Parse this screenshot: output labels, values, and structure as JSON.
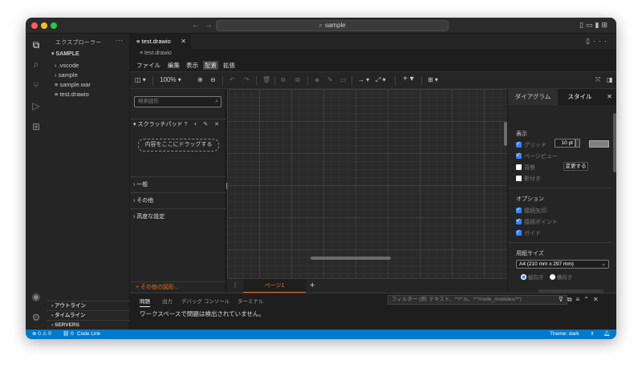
{
  "window": {
    "title": "sample"
  },
  "explorer": {
    "header": "エクスプローラー",
    "more": "···",
    "root": "SAMPLE",
    "items": [
      {
        "label": ".vscode",
        "kind": "folder"
      },
      {
        "label": "sample",
        "kind": "folder"
      },
      {
        "label": "sample.war",
        "kind": "file"
      },
      {
        "label": "test.drawio",
        "kind": "file"
      }
    ],
    "sections": [
      "アウトライン",
      "タイムライン",
      "SERVERS"
    ]
  },
  "editor": {
    "tab_label": "test.drawio",
    "breadcrumb": "test.drawio"
  },
  "menu": {
    "items": [
      "ファイル",
      "編集",
      "表示",
      "配置",
      "拡張"
    ],
    "highlighted": "配置"
  },
  "toolbar": {
    "zoom": "100%"
  },
  "shapes_panel": {
    "search_placeholder": "検索図形",
    "scratchpad_label": "スクラッチパッド",
    "scratchpad_tools": "? + ✎ ✕",
    "drop_hint": "内容をここにドラッグする",
    "sections": [
      "一般",
      "その他",
      "高度な設定"
    ],
    "more_shapes": "+ その他の図形..."
  },
  "pages": {
    "active": "ページ1"
  },
  "format_panel": {
    "tabs": [
      "ダイアグラム",
      "スタイル"
    ],
    "view_label": "表示",
    "view_options": [
      {
        "label": "グリッド",
        "checked": true
      },
      {
        "label": "ページビュー",
        "checked": true
      },
      {
        "label": "背景",
        "checked": false
      },
      {
        "label": "影付き",
        "checked": false
      }
    ],
    "grid_size": "10 pt",
    "change_button": "変更する",
    "options_label": "オプション",
    "options": [
      {
        "label": "接続矢印",
        "checked": true
      },
      {
        "label": "接続ポイント",
        "checked": true
      },
      {
        "label": "ガイド",
        "checked": true
      }
    ],
    "paper_label": "用紙サイズ",
    "paper_value": "A4 (210 mm x 297 mm)",
    "orientation": [
      "縦向き",
      "横向き"
    ],
    "orientation_selected": "縦向き"
  },
  "panel": {
    "tabs": [
      "問題",
      "出力",
      "デバッグ コンソール",
      "ターミナル"
    ],
    "active_tab": "問題",
    "filter_placeholder": "フィルター (例: テキスト、**/*.ts、!**/node_modules/**)",
    "message": "ワークスペースで問題は検出されていません。"
  },
  "statusbar": {
    "problems": "⊗ 0 ⚠ 0",
    "ports": "⛓ 0",
    "code_link": "Code Link",
    "theme": "Theme: dark"
  },
  "colors": {
    "accent": "#007acc",
    "drawio_orange": "#e7711b",
    "checkbox": "#3b82f6"
  }
}
